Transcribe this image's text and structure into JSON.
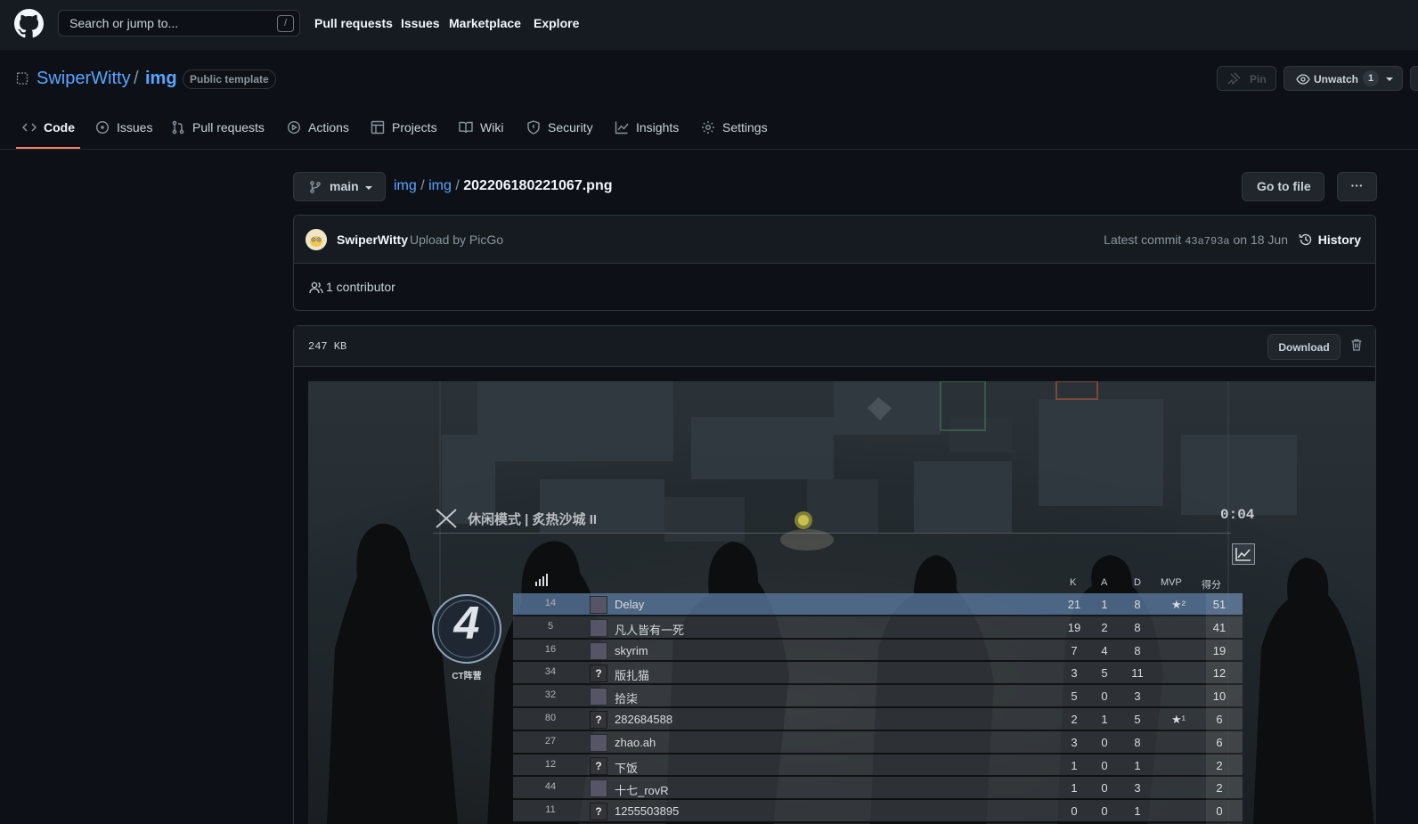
{
  "header": {
    "search_placeholder": "Search or jump to...",
    "search_key": "/",
    "nav": [
      "Pull requests",
      "Issues",
      "Marketplace",
      "Explore"
    ]
  },
  "repo": {
    "owner": "SwiperWitty",
    "separator": "/",
    "name": "img",
    "badge": "Public template",
    "pin_label": "Pin",
    "unwatch_label": "Unwatch",
    "watch_count": "1"
  },
  "tabs": [
    {
      "label": "Code",
      "icon": "code-icon"
    },
    {
      "label": "Issues",
      "icon": "issue-icon"
    },
    {
      "label": "Pull requests",
      "icon": "pull-request-icon"
    },
    {
      "label": "Actions",
      "icon": "play-icon"
    },
    {
      "label": "Projects",
      "icon": "table-icon"
    },
    {
      "label": "Wiki",
      "icon": "book-icon"
    },
    {
      "label": "Security",
      "icon": "shield-icon"
    },
    {
      "label": "Insights",
      "icon": "graph-icon"
    },
    {
      "label": "Settings",
      "icon": "gear-icon"
    }
  ],
  "file_nav": {
    "branch": "main",
    "crumb_1": "img",
    "crumb_2": "img",
    "file": "202206180221067.png",
    "goto_label": "Go to file",
    "more_label": "···"
  },
  "commit": {
    "author": "SwiperWitty",
    "message": "Upload by PicGo",
    "latest_prefix": "Latest commit",
    "sha": "43a793a",
    "date": "on 18 Jun",
    "history_label": "History",
    "contributors": "1 contributor"
  },
  "file": {
    "size": "247 KB",
    "download_label": "Download"
  },
  "game": {
    "mode": "休闲模式 | 炙热沙城 II",
    "timer": "0:04",
    "team_score": "4",
    "team_label": "CT阵营",
    "headers": {
      "k": "K",
      "a": "A",
      "d": "D",
      "mvp": "MVP",
      "score": "得分"
    },
    "players": [
      {
        "ping": "14",
        "avatar": "",
        "name": "Delay",
        "k": "21",
        "a": "1",
        "d": "8",
        "mvp": "★²",
        "score": "51"
      },
      {
        "ping": "5",
        "avatar": "",
        "name": "凡人皆有一死",
        "k": "19",
        "a": "2",
        "d": "8",
        "mvp": "",
        "score": "41"
      },
      {
        "ping": "16",
        "avatar": "",
        "name": "skyrim",
        "k": "7",
        "a": "4",
        "d": "8",
        "mvp": "",
        "score": "19"
      },
      {
        "ping": "34",
        "avatar": "?",
        "name": "版扎猫",
        "k": "3",
        "a": "5",
        "d": "11",
        "mvp": "",
        "score": "12"
      },
      {
        "ping": "32",
        "avatar": "",
        "name": "拾柒",
        "k": "5",
        "a": "0",
        "d": "3",
        "mvp": "",
        "score": "10"
      },
      {
        "ping": "80",
        "avatar": "?",
        "name": "282684588",
        "k": "2",
        "a": "1",
        "d": "5",
        "mvp": "★¹",
        "score": "6"
      },
      {
        "ping": "27",
        "avatar": "",
        "name": "zhao.ah",
        "k": "3",
        "a": "0",
        "d": "8",
        "mvp": "",
        "score": "6"
      },
      {
        "ping": "12",
        "avatar": "?",
        "name": "下饭",
        "k": "1",
        "a": "0",
        "d": "1",
        "mvp": "",
        "score": "2"
      },
      {
        "ping": "44",
        "avatar": "",
        "name": "十七_rovR",
        "k": "1",
        "a": "0",
        "d": "3",
        "mvp": "",
        "score": "2"
      },
      {
        "ping": "11",
        "avatar": "?",
        "name": "1255503895",
        "k": "0",
        "a": "0",
        "d": "1",
        "mvp": "",
        "score": "0"
      }
    ]
  },
  "colors": {
    "bg": "#0d1117",
    "header_bg": "#161b22",
    "link": "#58a6ff",
    "border": "#30363d",
    "tab_underline": "#f78166",
    "highlight_row": "#58789e"
  }
}
